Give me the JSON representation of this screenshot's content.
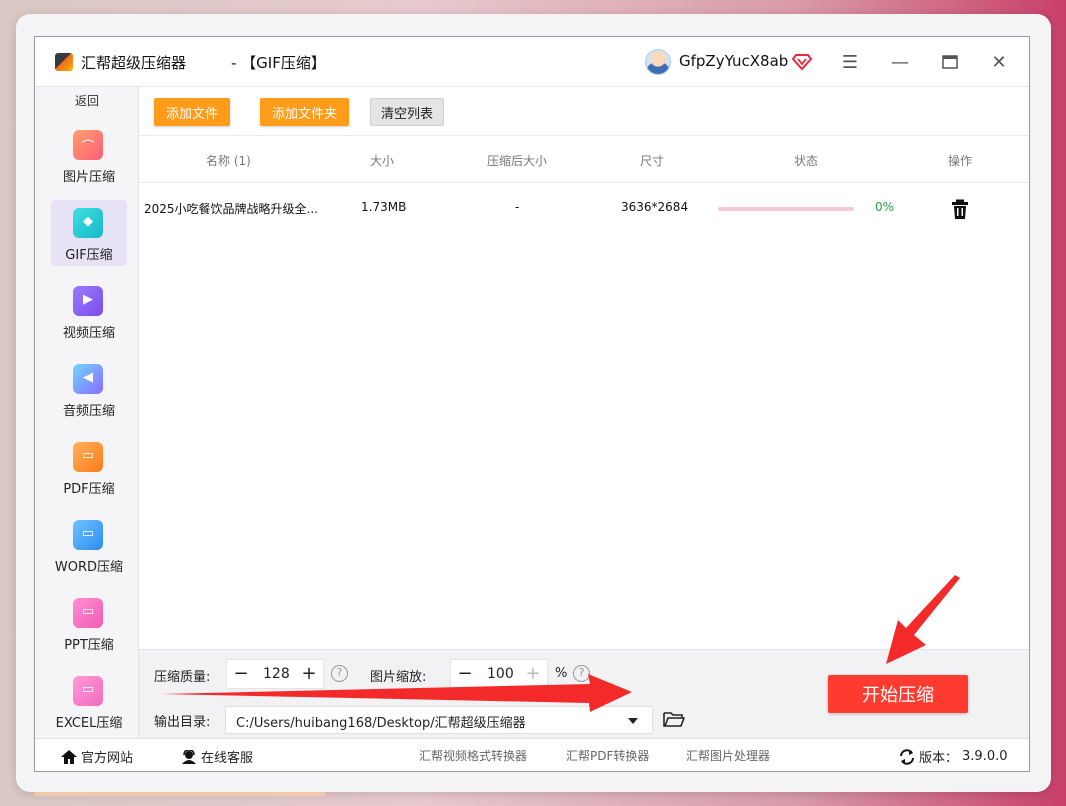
{
  "window": {
    "title": "汇帮超级压缩器",
    "mode": "-  【GIF压缩】",
    "username": "GfpZyYucX8ab",
    "accent_color": "#ff9c1a",
    "start_color": "#ff3b30"
  },
  "sidebar": {
    "back_label": "返回",
    "items": [
      {
        "label": "图片压缩",
        "icon": "image-icon"
      },
      {
        "label": "GIF压缩",
        "icon": "gif-icon"
      },
      {
        "label": "视频压缩",
        "icon": "video-icon"
      },
      {
        "label": "音频压缩",
        "icon": "audio-icon"
      },
      {
        "label": "PDF压缩",
        "icon": "pdf-icon"
      },
      {
        "label": "WORD压缩",
        "icon": "word-icon"
      },
      {
        "label": "PPT压缩",
        "icon": "ppt-icon"
      },
      {
        "label": "EXCEL压缩",
        "icon": "excel-icon"
      }
    ],
    "active_index": 1
  },
  "toolbar": {
    "add_file": "添加文件",
    "add_folder": "添加文件夹",
    "clear_list": "清空列表"
  },
  "table": {
    "headers": [
      "名称 (1)",
      "大小",
      "压缩后大小",
      "尺寸",
      "状态",
      "操作"
    ],
    "rows": [
      {
        "name": "2025小吃餐饮品牌战略升级全...",
        "size": "1.73MB",
        "compressed": "-",
        "dimensions": "3636*2684",
        "progress": 0,
        "status": "0%"
      }
    ]
  },
  "settings": {
    "quality_label": "压缩质量:",
    "quality_value": "128",
    "scale_label": "图片缩放:",
    "scale_value": "100",
    "scale_unit": "%",
    "output_label": "输出目录:",
    "output_path": "C:/Users/huibang168/Desktop/汇帮超级压缩器",
    "start_button": "开始压缩"
  },
  "footer": {
    "website": "官方网站",
    "support": "在线客服",
    "links": [
      "汇帮视频格式转换器",
      "汇帮PDF转换器",
      "汇帮图片处理器"
    ],
    "version_label": "版本：",
    "version": "3.9.0.0"
  }
}
